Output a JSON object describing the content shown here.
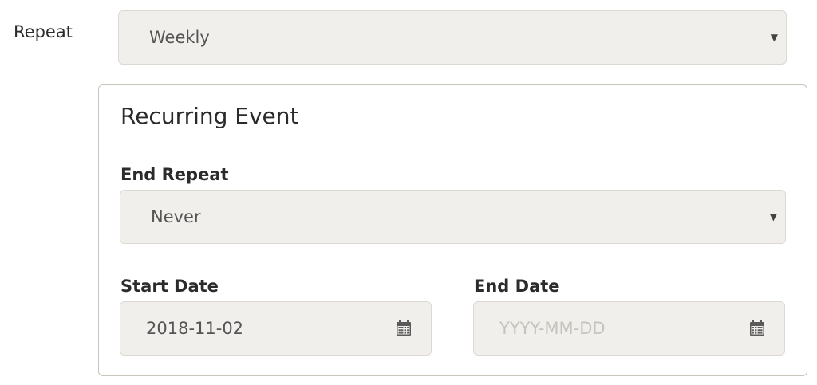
{
  "repeat": {
    "label": "Repeat",
    "value": "Weekly",
    "caret": "▼"
  },
  "recurring_event": {
    "title": "Recurring Event",
    "end_repeat": {
      "label": "End Repeat",
      "value": "Never",
      "caret": "▼"
    },
    "start_date": {
      "label": "Start Date",
      "value": "2018-11-02",
      "icon": "calendar-icon"
    },
    "end_date": {
      "label": "End Date",
      "value": "",
      "placeholder": "YYYY-MM-DD",
      "icon": "calendar-icon"
    }
  }
}
